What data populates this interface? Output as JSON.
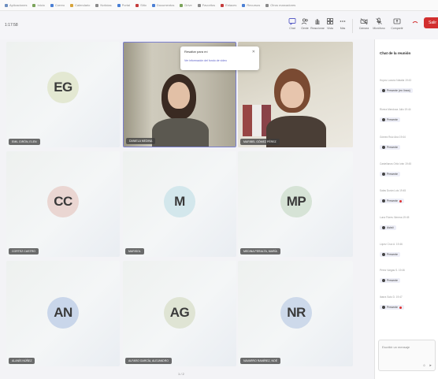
{
  "browser": {
    "bookmarks": [
      {
        "label": "Aplicaciones",
        "color": "#6c8ebf"
      },
      {
        "label": "Inicio",
        "color": "#7aa35a"
      },
      {
        "label": "Correo",
        "color": "#4a7fd4"
      },
      {
        "label": "Calendario",
        "color": "#d6a33a"
      },
      {
        "label": "Noticias",
        "color": "#8a8a8a"
      },
      {
        "label": "Portal",
        "color": "#4a7fd4"
      },
      {
        "label": "Sitio",
        "color": "#c43b3b"
      },
      {
        "label": "Documentos",
        "color": "#4a7fd4"
      },
      {
        "label": "Drive",
        "color": "#7aa35a"
      },
      {
        "label": "Favoritos",
        "color": "#8a8a8a"
      },
      {
        "label": "Enlaces",
        "color": "#c43b3b"
      },
      {
        "label": "Recursos",
        "color": "#4a7fd4"
      },
      {
        "label": "Otros marcadores",
        "color": "#8a8a8a"
      }
    ]
  },
  "toolbar": {
    "meeting_time": "1:17:58",
    "buttons": [
      {
        "label": "Chat",
        "icon": "chat-icon"
      },
      {
        "label": "Gente",
        "icon": "people-icon"
      },
      {
        "label": "Reaccionar",
        "icon": "hand-icon"
      },
      {
        "label": "Vista",
        "icon": "view-icon"
      },
      {
        "label": "Más",
        "icon": "more-icon"
      },
      {
        "label": "Cámara",
        "icon": "camera-icon"
      },
      {
        "label": "Micrófono",
        "icon": "mic-icon"
      },
      {
        "label": "Compartir",
        "icon": "share-icon"
      }
    ],
    "leave_label": "Salir"
  },
  "participants": [
    {
      "initials": "EG",
      "name": "EMIL GIRÓN, ELEN",
      "avatar_color": "#e3e8d2"
    },
    {
      "initials": "",
      "name": "DANIELA MEDINA",
      "video": true
    },
    {
      "initials": "",
      "name": "MARIBEL GÓMEZ PÉREZ",
      "video": true
    },
    {
      "initials": "CC",
      "name": "CORTEZ CASTRO",
      "avatar_color": "#ead6d2"
    },
    {
      "initials": "M",
      "name": "MARISOL",
      "avatar_color": "#d3e7ec"
    },
    {
      "initials": "MP",
      "name": "MEDINA PERALTA, MARÍA",
      "avatar_color": "#d6e3d6"
    },
    {
      "initials": "AN",
      "name": "ALANÍS NÚÑEZ",
      "avatar_color": "#c9d6ea"
    },
    {
      "initials": "AG",
      "name": "ALFARO GARCÍA, ALEJANDRO",
      "avatar_color": "#dfe4d4"
    },
    {
      "initials": "NR",
      "name": "NAVARRO RAMÍREZ, NOÉ",
      "avatar_color": "#cdd9ea"
    }
  ],
  "popup": {
    "title": "Resaltar para mí",
    "subtitle": "Ver información del fondo de video"
  },
  "chat": {
    "title": "Chat de la reunión",
    "messages": [
      {
        "meta": "Hoyos Lozano Natalia  19:43",
        "text": "Presente (en línea)",
        "flag": false
      },
      {
        "meta": "Rivera Mendoza Julio  19:44",
        "text": "Presente",
        "flag": false
      },
      {
        "meta": "Gómez Ruiz Ana  19:44",
        "text": "Presente",
        "flag": false
      },
      {
        "meta": "Castellanos Ortiz Iván  19:45",
        "text": "Presente",
        "flag": false
      },
      {
        "meta": "Salas Durán Luis  19:45",
        "text": "Presente",
        "flag": true
      },
      {
        "meta": "Luna Flores Ximena  19:45",
        "text": "Asistí",
        "flag": false
      },
      {
        "meta": "López Cruz A.  19:46",
        "text": "Presente",
        "flag": false
      },
      {
        "meta": "Pérez Vargas S.  19:46",
        "text": "Presente",
        "flag": false
      },
      {
        "meta": "Ibarra Soto D.  19:47",
        "text": "Presente",
        "flag": true
      }
    ],
    "compose_placeholder": "Escribir un mensaje"
  },
  "pager_text": "1 / 2"
}
